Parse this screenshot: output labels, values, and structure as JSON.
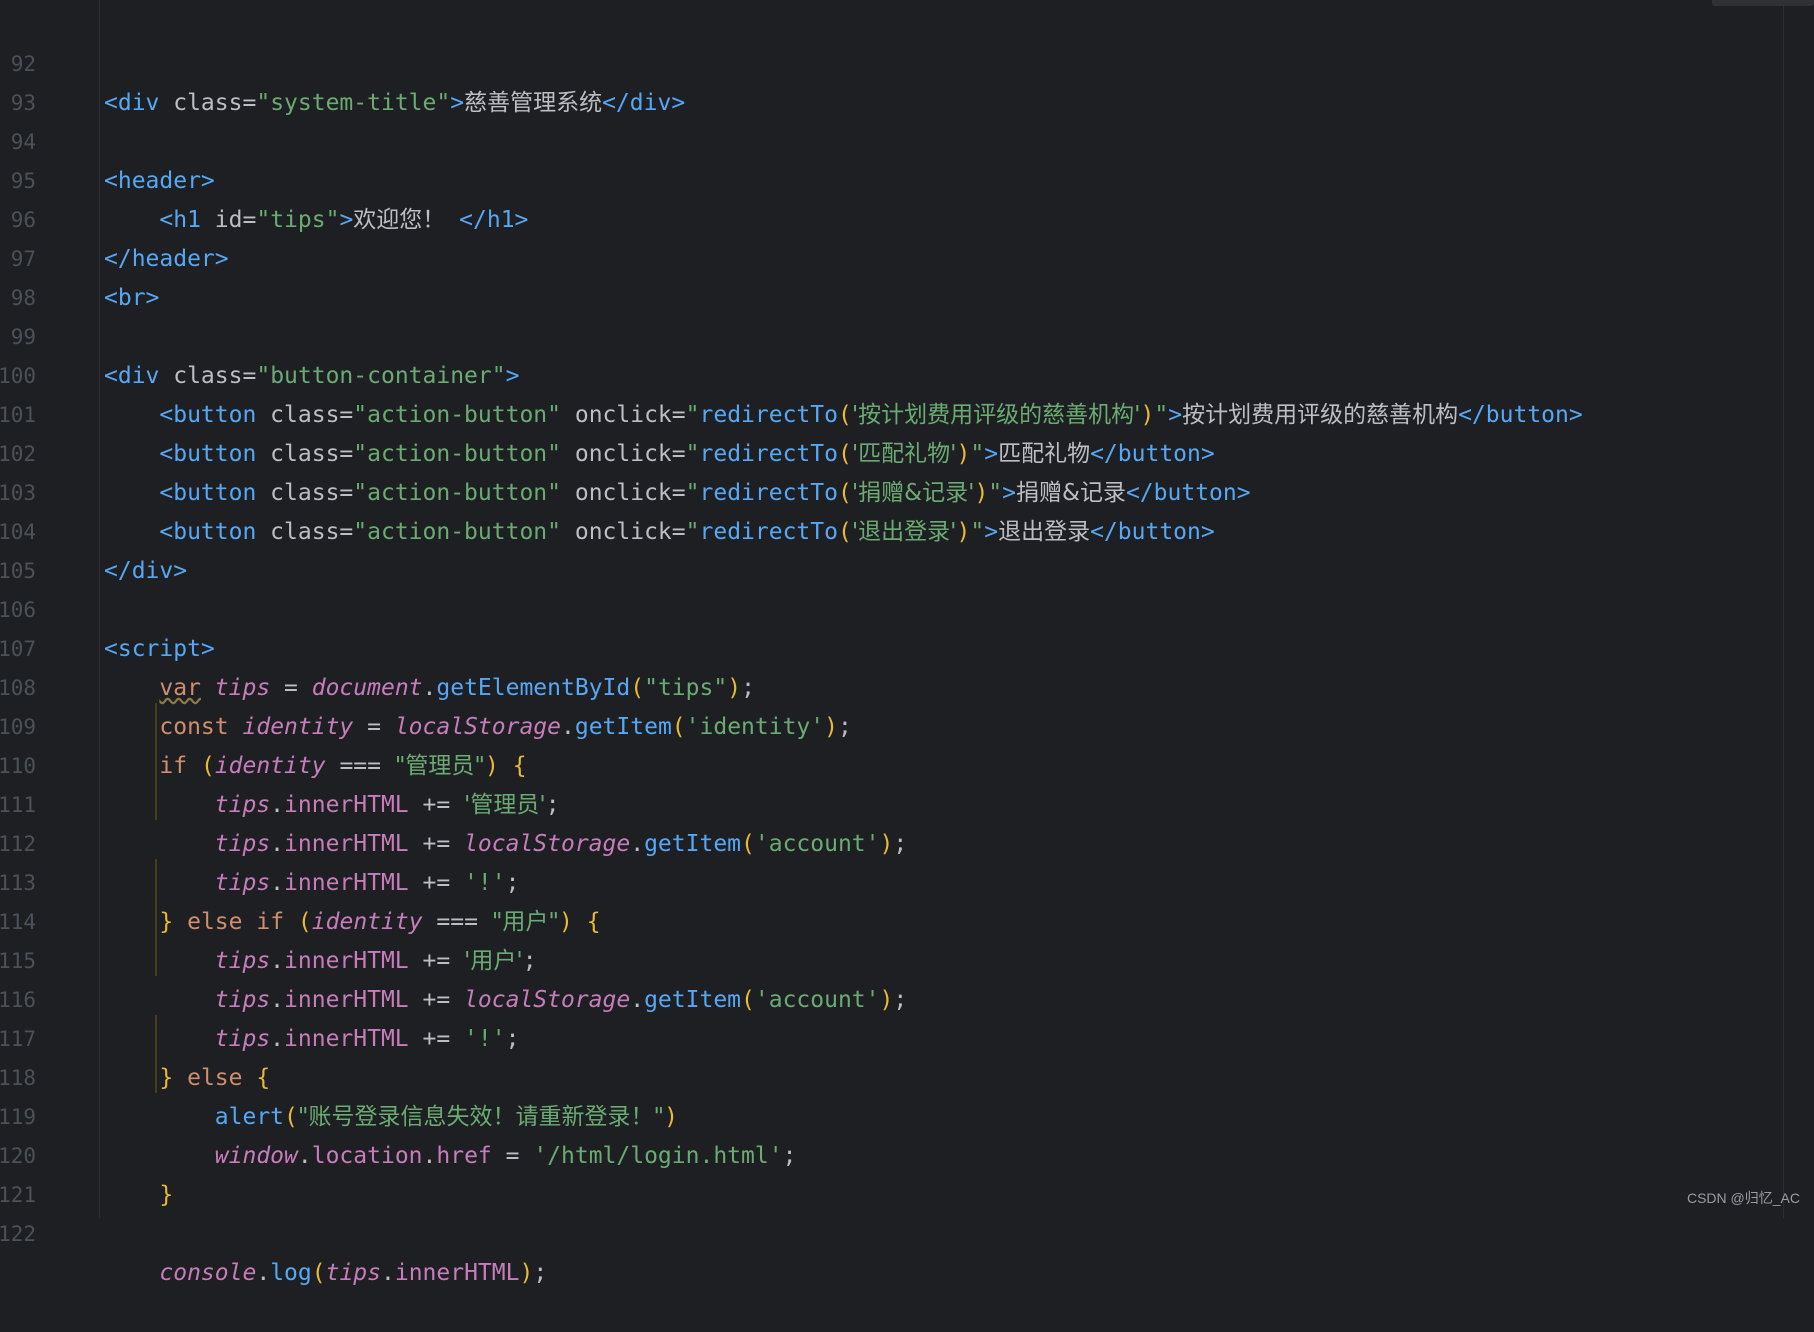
{
  "editor": {
    "line_numbers": [
      "92",
      "93",
      "94",
      "95",
      "96",
      "97",
      "98",
      "99",
      "100",
      "101",
      "102",
      "103",
      "104",
      "105",
      "106",
      "107",
      "108",
      "109",
      "110",
      "111",
      "112",
      "113",
      "114",
      "115",
      "116",
      "117",
      "118",
      "119",
      "120",
      "121",
      "122"
    ],
    "html": {
      "div_open_tag": "<div",
      "class_attr": " class",
      "eq": "=",
      "system_title_value": "\"system-title\"",
      "close_angle": ">",
      "system_title_text": "慈善管理系统",
      "div_close_tag": "</div>",
      "header_open": "<header>",
      "h1_open": "<h1",
      "id_attr": " id",
      "tips_value": "\"tips\"",
      "welcome_text": "欢迎您！",
      "h1_close": "</h1>",
      "header_close": "</header>",
      "br_tag": "<br>",
      "button_container_value": "\"button-container\"",
      "button_open": "<button",
      "action_button_value": "\"action-button\"",
      "onclick_attr": " onclick",
      "quote": "\"",
      "redirect_fn": "redirectTo",
      "paren_open": "(",
      "paren_close": ")",
      "btn1_arg": "'按计划费用评级的慈善机构'",
      "btn1_text": "按计划费用评级的慈善机构",
      "btn2_arg": "'匹配礼物'",
      "btn2_text": "匹配礼物",
      "btn3_arg": "'捐赠&记录'",
      "btn3_text": "捐赠&记录",
      "btn4_arg": "'退出登录'",
      "btn4_text": "退出登录",
      "button_close": "</button>",
      "script_open": "<script>"
    },
    "js": {
      "var_kw": "var",
      "tips_var": "tips",
      "assign": " = ",
      "document_obj": "document",
      "dot": ".",
      "get_element_by_id": "getElementById",
      "tips_str": "\"tips\"",
      "semicolon": ";",
      "const_kw": "const",
      "identity_var": "identity",
      "local_storage": "localStorage",
      "get_item": "getItem",
      "identity_str": "'identity'",
      "if_kw": "if",
      "triple_eq": " === ",
      "admin_str": "\"管理员\"",
      "brace_open": "{",
      "brace_close": "}",
      "inner_html": "innerHTML",
      "plus_eq": " += ",
      "admin_str_single": "'管理员'",
      "account_str": "'account'",
      "bang_str": "'!'",
      "else_kw": "else",
      "user_str": "\"用户\"",
      "user_str_single": "'用户'",
      "alert_fn": "alert",
      "alert_msg": "\"账号登录信息失效！请重新登录！\"",
      "window_obj": "window",
      "location_prop": "location",
      "href_prop": "href",
      "login_path": "'/html/login.html'",
      "console_obj": "console",
      "log_fn": "log"
    }
  },
  "watermark": "CSDN @归忆_AC"
}
